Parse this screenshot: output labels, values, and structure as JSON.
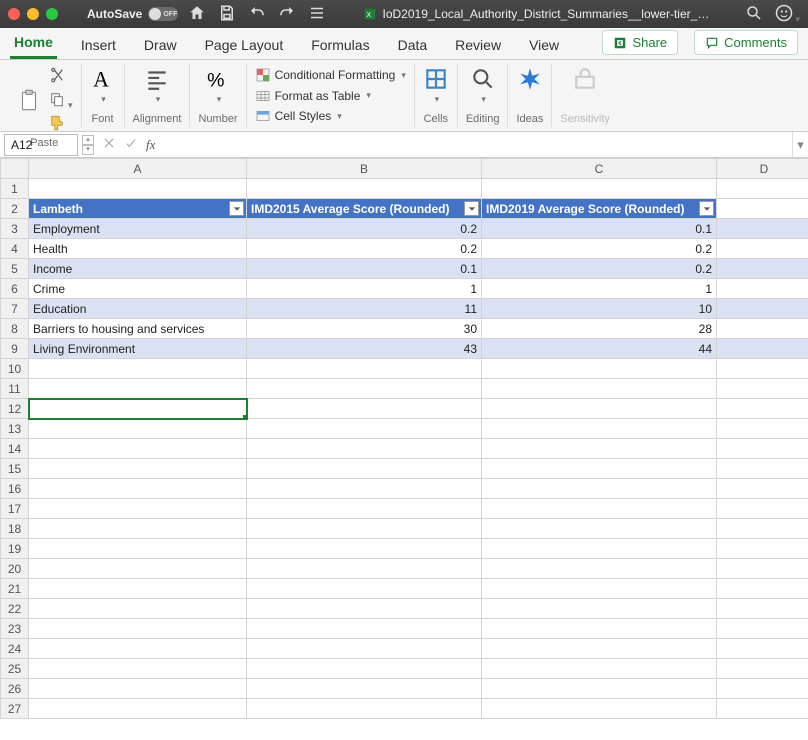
{
  "titlebar": {
    "autosave_label": "AutoSave",
    "autosave_state": "OFF",
    "docname": "IoD2019_Local_Authority_District_Summaries__lower-tier_…"
  },
  "tabs": {
    "items": [
      "Home",
      "Insert",
      "Draw",
      "Page Layout",
      "Formulas",
      "Data",
      "Review",
      "View"
    ],
    "active": 0,
    "share": "Share",
    "comments": "Comments"
  },
  "ribbon": {
    "paste": "Paste",
    "font": "Font",
    "alignment": "Alignment",
    "number": "Number",
    "cond_fmt": "Conditional Formatting",
    "as_table": "Format as Table",
    "cell_styles": "Cell Styles",
    "cells": "Cells",
    "editing": "Editing",
    "ideas": "Ideas",
    "sensitivity": "Sensitivity"
  },
  "namebox": "A12",
  "formula": "",
  "columns": [
    "A",
    "B",
    "C",
    "D"
  ],
  "rows_shown": 27,
  "table": {
    "header": [
      "Lambeth",
      "IMD2015 Average Score (Rounded)",
      "IMD2019 Average Score (Rounded)"
    ],
    "rows": [
      {
        "label": "Employment",
        "v2015": "0.2",
        "v2019": "0.1",
        "band": true
      },
      {
        "label": "Health",
        "v2015": "0.2",
        "v2019": "0.2",
        "band": false
      },
      {
        "label": "Income",
        "v2015": "0.1",
        "v2019": "0.2",
        "band": true
      },
      {
        "label": "Crime",
        "v2015": "1",
        "v2019": "1",
        "band": false
      },
      {
        "label": "Education",
        "v2015": "11",
        "v2019": "10",
        "band": true
      },
      {
        "label": "Barriers to housing and services",
        "v2015": "30",
        "v2019": "28",
        "band": false
      },
      {
        "label": "Living Environment",
        "v2015": "43",
        "v2019": "44",
        "band": true
      }
    ]
  },
  "selected_cell": "A12"
}
